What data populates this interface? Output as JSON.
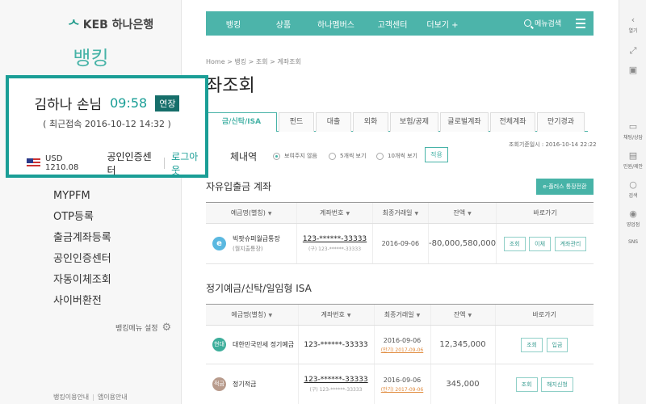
{
  "brand": {
    "logo_text": "KEB 하나은행",
    "section": "뱅킹"
  },
  "login": {
    "name": "김하나 손님",
    "timer": "09:58",
    "extend": "연장",
    "last_login": "( 최근접속   2016-10-12  14:32 )",
    "usd": "USD  1210.08",
    "cert": "공인인증센터",
    "logout": "로그아웃"
  },
  "sidebar": {
    "items": [
      "MYPFM",
      "OTP등록",
      "출금계좌등록",
      "공인인증센터",
      "자동이체조회",
      "사이버환전"
    ],
    "setting": "뱅킹메뉴 설정",
    "footer_left": "뱅킹이용안내",
    "footer_right": "앱이용안내"
  },
  "nav": {
    "items": [
      "뱅킹",
      "상품",
      "하나멤버스",
      "고객센터",
      "더보기 +"
    ],
    "search": "메뉴검색"
  },
  "breadcrumb": "Home  >  뱅킹  >  조회  >  계좌조회",
  "page_title": "좌조회",
  "tabs": [
    "금/신탁/ISA",
    "펀드",
    "대출",
    "외화",
    "보험/공제",
    "글로벌계좌",
    "전체계좌",
    "만기경과"
  ],
  "filter": {
    "label": "체내역",
    "options": [
      "보여주지 않음",
      "5개씩 보기",
      "10개씩 보기"
    ],
    "apply": "적용",
    "std_time": "조회기준일시 : 2016-10-14 22:22"
  },
  "section1": {
    "title": "자유입출금 계좌",
    "convert": "e-플러스 통장전환",
    "headers": [
      "예금명(별칭)",
      "계좌번호",
      "최종거래일",
      "잔액",
      "바로가기"
    ],
    "rows": [
      {
        "badge": "e",
        "name": "빅팟슈퍼월급통장",
        "sub": "(월지출통장)",
        "acct": "123-******-33333",
        "acct_sub": "(구) 123-******-33333",
        "date": "2016-09-06",
        "balance": "-80,000,580,000",
        "actions": [
          "조회",
          "이체",
          "계좌관리"
        ]
      }
    ]
  },
  "section2": {
    "title": "정기예금/신탁/일임형 ISA",
    "headers": [
      "예금명(별칭)",
      "계좌번호",
      "최종거래일",
      "잔액",
      "바로가기"
    ],
    "rows": [
      {
        "badge": "현대",
        "name": "대한민국만세 정기예금",
        "acct": "123-******-33333",
        "date": "2016-09-06",
        "maturity": "(만기) 2017-09-06",
        "balance": "12,345,000",
        "actions": [
          "조회",
          "입금"
        ]
      },
      {
        "badge": "적금",
        "name": "정기적금",
        "acct": "123-******-33333",
        "acct_sub": "(구) 123-******-33333",
        "date": "2016-09-06",
        "maturity": "(만기) 2017-09-06",
        "balance": "345,000",
        "actions": [
          "조회",
          "해지신청"
        ]
      }
    ]
  },
  "rail": {
    "items": [
      "열기",
      "",
      "",
      "채팅/상담",
      "민원/제안",
      "검색",
      "영업점",
      "SNS"
    ]
  }
}
